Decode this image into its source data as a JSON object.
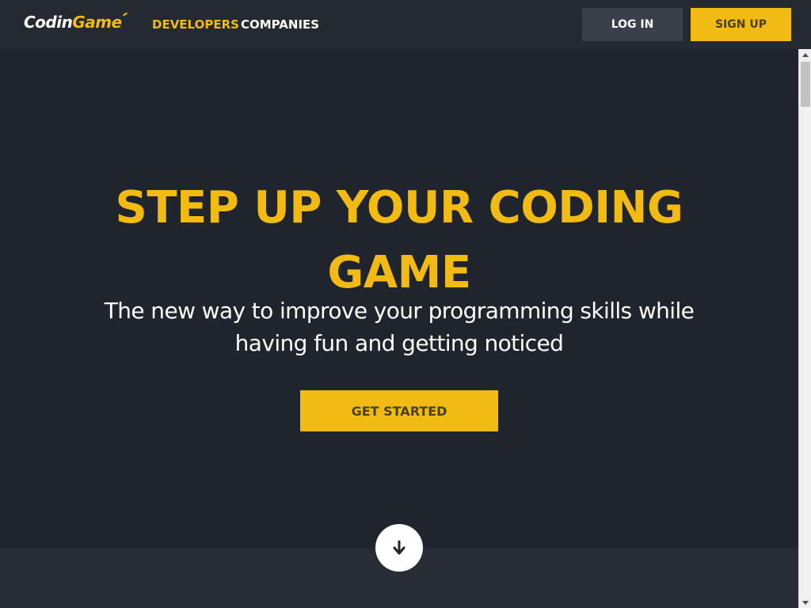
{
  "header": {
    "logo": {
      "prefix": "Codin",
      "suffix": "Game"
    },
    "nav": {
      "developers": "DEVELOPERS",
      "companies": "COMPANIES"
    },
    "login_label": "LOG IN",
    "signup_label": "SIGN UP"
  },
  "hero": {
    "title_line1": "STEP UP YOUR CODING",
    "title_line2": "GAME",
    "subtitle_line1": "The new way to improve your programming skills while",
    "subtitle_line2": "having fun and getting noticed",
    "cta_label": "GET STARTED"
  },
  "icons": {
    "scroll_down": "arrow-down-icon",
    "scroll_up": "triangle-up-icon",
    "scroll_bottom": "triangle-down-icon"
  },
  "colors": {
    "accent": "#f2bb13",
    "background": "#20242c",
    "header_background": "#252932",
    "login_button": "#3a3f49",
    "text_light": "#ffffff"
  }
}
